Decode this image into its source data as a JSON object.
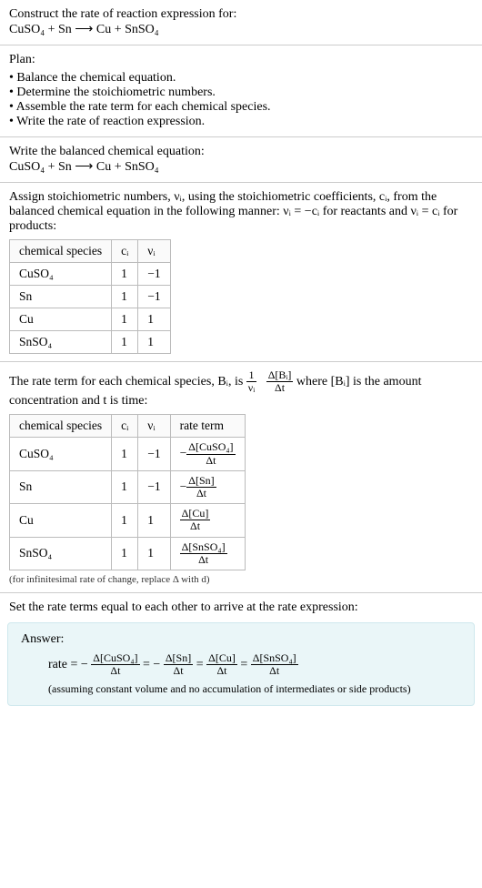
{
  "intro": {
    "title": "Construct the rate of reaction expression for:",
    "equation": "CuSO₄ + Sn  ⟶  Cu + SnSO₄"
  },
  "plan": {
    "heading": "Plan:",
    "items": [
      "Balance the chemical equation.",
      "Determine the stoichiometric numbers.",
      "Assemble the rate term for each chemical species.",
      "Write the rate of reaction expression."
    ]
  },
  "balanced": {
    "heading": "Write the balanced chemical equation:",
    "equation": "CuSO₄ + Sn  ⟶  Cu + SnSO₄"
  },
  "stoich": {
    "text": "Assign stoichiometric numbers, νᵢ, using the stoichiometric coefficients, cᵢ, from the balanced chemical equation in the following manner: νᵢ = −cᵢ for reactants and νᵢ = cᵢ for products:",
    "headers": {
      "species": "chemical species",
      "c": "cᵢ",
      "v": "νᵢ"
    },
    "rows": [
      {
        "species": "CuSO₄",
        "c": "1",
        "v": "−1"
      },
      {
        "species": "Sn",
        "c": "1",
        "v": "−1"
      },
      {
        "species": "Cu",
        "c": "1",
        "v": "1"
      },
      {
        "species": "SnSO₄",
        "c": "1",
        "v": "1"
      }
    ]
  },
  "rateterm": {
    "text_before": "The rate term for each chemical species, Bᵢ, is ",
    "text_after": " where [Bᵢ] is the amount concentration and t is time:",
    "frac1_num": "1",
    "frac1_den": "νᵢ",
    "frac2_num": "Δ[Bᵢ]",
    "frac2_den": "Δt",
    "headers": {
      "species": "chemical species",
      "c": "cᵢ",
      "v": "νᵢ",
      "rate": "rate term"
    },
    "rows": [
      {
        "species": "CuSO₄",
        "c": "1",
        "v": "−1",
        "prefix": "−",
        "num": "Δ[CuSO₄]",
        "den": "Δt"
      },
      {
        "species": "Sn",
        "c": "1",
        "v": "−1",
        "prefix": "−",
        "num": "Δ[Sn]",
        "den": "Δt"
      },
      {
        "species": "Cu",
        "c": "1",
        "v": "1",
        "prefix": "",
        "num": "Δ[Cu]",
        "den": "Δt"
      },
      {
        "species": "SnSO₄",
        "c": "1",
        "v": "1",
        "prefix": "",
        "num": "Δ[SnSO₄]",
        "den": "Δt"
      }
    ],
    "note": "(for infinitesimal rate of change, replace Δ with d)"
  },
  "final": {
    "heading": "Set the rate terms equal to each other to arrive at the rate expression:"
  },
  "answer": {
    "label": "Answer:",
    "rate_prefix": "rate = −",
    "eq_sep_neg": " = −",
    "eq_sep": " = ",
    "terms": [
      {
        "num": "Δ[CuSO₄]",
        "den": "Δt"
      },
      {
        "num": "Δ[Sn]",
        "den": "Δt"
      },
      {
        "num": "Δ[Cu]",
        "den": "Δt"
      },
      {
        "num": "Δ[SnSO₄]",
        "den": "Δt"
      }
    ],
    "assume": "(assuming constant volume and no accumulation of intermediates or side products)"
  }
}
